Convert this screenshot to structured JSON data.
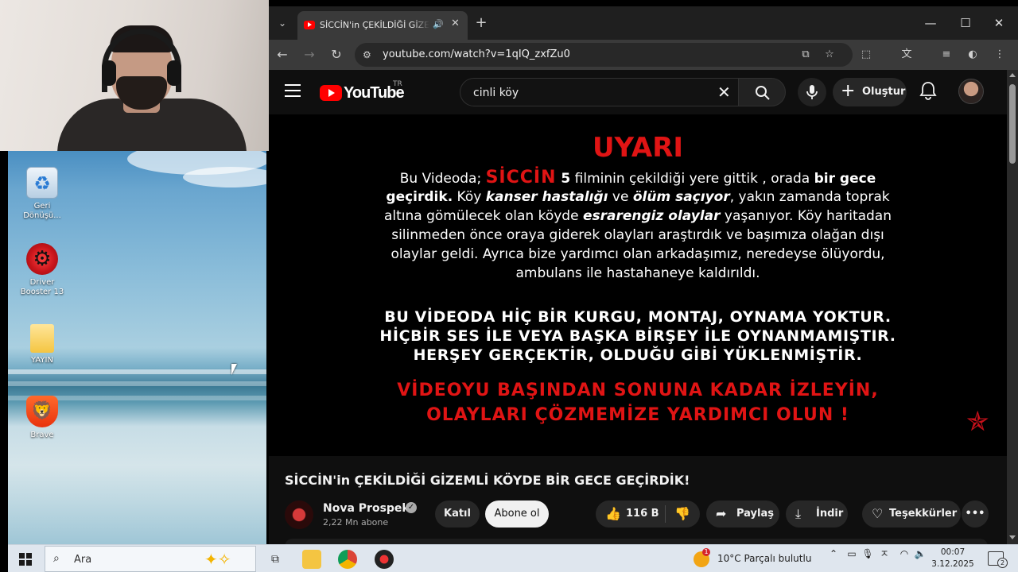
{
  "browser": {
    "tab_title": "SİCCİN'in ÇEKİLDİĞİ GİZEMLİ KÖYDE BİR GECE GEÇİRDİK!",
    "url": "youtube.com/watch?v=1qIQ_zxfZu0"
  },
  "youtube": {
    "logo_text": "YouTube",
    "region": "TR",
    "search_query": "cinli köy",
    "create_label": "Oluştur"
  },
  "video_overlay": {
    "title": "UYARI",
    "intro_prefix": "Bu Videoda; ",
    "intro_siccin": "SİCCİN",
    "intro_num": " 5",
    "intro_rest": " filminin çekildiği yere gittik , orada ",
    "intro_bold": "bir gece",
    "line2_bold": "geçirdik.",
    "line2_mid": " Köy ",
    "line2_it1": "kanser hastalığı",
    "line2_ve": " ve ",
    "line2_it2": "ölüm saçıyor",
    "line2_end": ", yakın zamanda toprak",
    "line3_start": "altına gömülecek olan köyde ",
    "line3_it": "esrarengiz olaylar",
    "line3_end": " yaşanıyor. Köy haritadan",
    "line4": "silinmeden önce oraya giderek olayları araştırdık ve başımıza olağan dışı",
    "line5": "olaylar geldi. Ayrıca bize yardımcı olan arkadaşımız, neredeyse ölüyordu,",
    "line6": "ambulans ile hastahaneye kaldırıldı.",
    "caps1": "BU VİDEODA HİÇ BİR KURGU, MONTAJ, OYNAMA YOKTUR.",
    "caps2": "HİÇBİR SES İLE VEYA BAŞKA BİRŞEY İLE OYNANMAMIŞTIR.",
    "caps3": "HERŞEY GERÇEKTİR, OLDUĞU GİBİ YÜKLENMİŞTİR.",
    "red1": "VİDEOYU BAŞINDAN SONUNA KADAR İZLEYİN,",
    "red2": "OLAYLARI ÇÖZMEMİZE YARDIMCI OLUN !"
  },
  "video_info": {
    "title": "SİCCİN'in ÇEKİLDİĞİ GİZEMLİ KÖYDE BİR GECE GEÇİRDİK!",
    "channel": "Nova Prospekt",
    "subscribers": "2,22 Mn abone",
    "join_label": "Katıl",
    "subscribe_label": "Abone ol",
    "likes": "116 B",
    "share_label": "Paylaş",
    "download_label": "İndir",
    "thanks_label": "Teşekkürler"
  },
  "desktop": {
    "icons": [
      {
        "label": "Geri\nDönüşü..."
      },
      {
        "label": "Driver\nBooster 13"
      },
      {
        "label": "YAYIN"
      },
      {
        "label": "Brave"
      }
    ]
  },
  "taskbar": {
    "search_placeholder": "Ara",
    "weather": "10°C  Parçalı bulutlu",
    "weather_badge": "1",
    "time": "00:07",
    "date": "3.12.2025",
    "notification_count": "2"
  },
  "colors": {
    "youtube_red": "#ff0000",
    "warning_red": "#e01414",
    "taskbar_bg": "#dfe6ee"
  }
}
